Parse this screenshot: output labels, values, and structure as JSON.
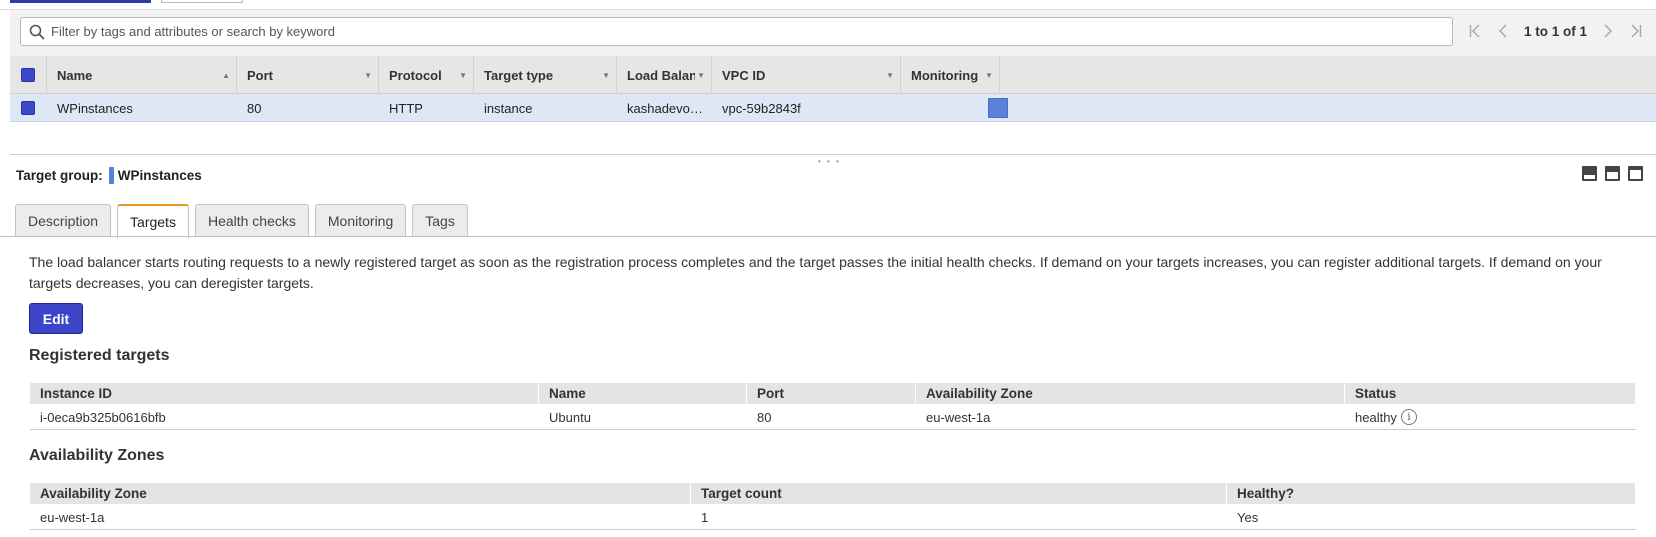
{
  "search": {
    "placeholder": "Filter by tags and attributes or search by keyword"
  },
  "pagination": {
    "text": "1 to 1 of 1"
  },
  "grid": {
    "columns": [
      {
        "label": "Name",
        "sort": "asc"
      },
      {
        "label": "Port"
      },
      {
        "label": "Protocol"
      },
      {
        "label": "Target type"
      },
      {
        "label": "Load Balancer"
      },
      {
        "label": "VPC ID"
      },
      {
        "label": "Monitoring"
      }
    ],
    "row": {
      "name": "WPinstances",
      "port": "80",
      "protocol": "HTTP",
      "target_type": "instance",
      "load_balancer": "kashadevo…",
      "vpc_id": "vpc-59b2843f"
    }
  },
  "detail": {
    "title_label": "Target group:",
    "title_value": "WPinstances",
    "tabs": [
      "Description",
      "Targets",
      "Health checks",
      "Monitoring",
      "Tags"
    ],
    "active_tab": "Targets",
    "description": "The load balancer starts routing requests to a newly registered target as soon as the registration process completes and the target passes the initial health checks. If demand on your targets increases, you can register additional targets. If demand on your targets decreases, you can deregister targets.",
    "edit_label": "Edit",
    "registered": {
      "heading": "Registered targets",
      "headers": [
        "Instance ID",
        "Name",
        "Port",
        "Availability Zone",
        "Status"
      ],
      "row": {
        "instance_id": "i-0eca9b325b0616bfb",
        "name": "Ubuntu",
        "port": "80",
        "az": "eu-west-1a",
        "status": "healthy"
      }
    },
    "zones": {
      "heading": "Availability Zones",
      "headers": [
        "Availability Zone",
        "Target count",
        "Healthy?"
      ],
      "row": {
        "az": "eu-west-1a",
        "count": "1",
        "healthy": "Yes"
      }
    }
  },
  "colors": {
    "accent": "#3c44c7",
    "selected_row": "#dde7f6",
    "tag_color": "#5b80d8",
    "active_tab_border": "#e69a1f"
  },
  "icons": [
    "search-icon",
    "first-page-icon",
    "prev-page-icon",
    "next-page-icon",
    "last-page-icon",
    "sort-asc-icon",
    "column-menu-icon",
    "info-icon",
    "panel-layout-icon"
  ]
}
